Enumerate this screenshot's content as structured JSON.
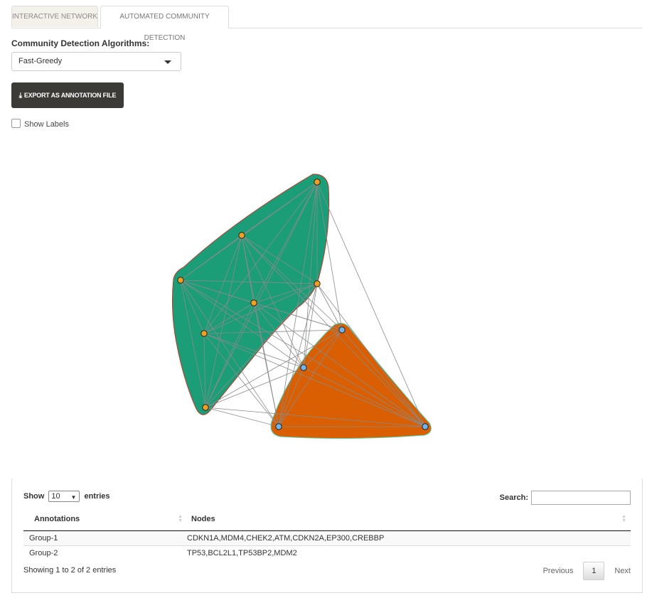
{
  "tabs": [
    {
      "label": "INTERACTIVE NETWORK"
    },
    {
      "label": "AUTOMATED COMMUNITY DETECTION"
    }
  ],
  "algorithm": {
    "label": "Community Detection Algorithms:",
    "selected": "Fast-Greedy"
  },
  "export_button": {
    "label": "EXPORT AS ANNOTATION FILE",
    "icon": "download-icon"
  },
  "show_labels": {
    "label": "Show Labels",
    "checked": false
  },
  "network": {
    "groups": [
      {
        "name": "Group-1",
        "fill": "#1b9e77",
        "node_color": "#f0a020"
      },
      {
        "name": "Group-2",
        "fill": "#d95f02",
        "node_color": "#70b4ec"
      }
    ],
    "edge_color": "#8a8a8a"
  },
  "table": {
    "length_label_pre": "Show",
    "length_value": "10",
    "length_label_post": "entries",
    "search_label": "Search:",
    "columns": [
      "Annotations",
      "Nodes"
    ],
    "rows": [
      {
        "annotation": "Group-1",
        "nodes": "CDKN1A,MDM4,CHEK2,ATM,CDKN2A,EP300,CREBBP"
      },
      {
        "annotation": "Group-2",
        "nodes": "TP53,BCL2L1,TP53BP2,MDM2"
      }
    ],
    "info": "Showing 1 to 2 of 2 entries",
    "pagination": {
      "previous": "Previous",
      "current": "1",
      "next": "Next"
    }
  }
}
